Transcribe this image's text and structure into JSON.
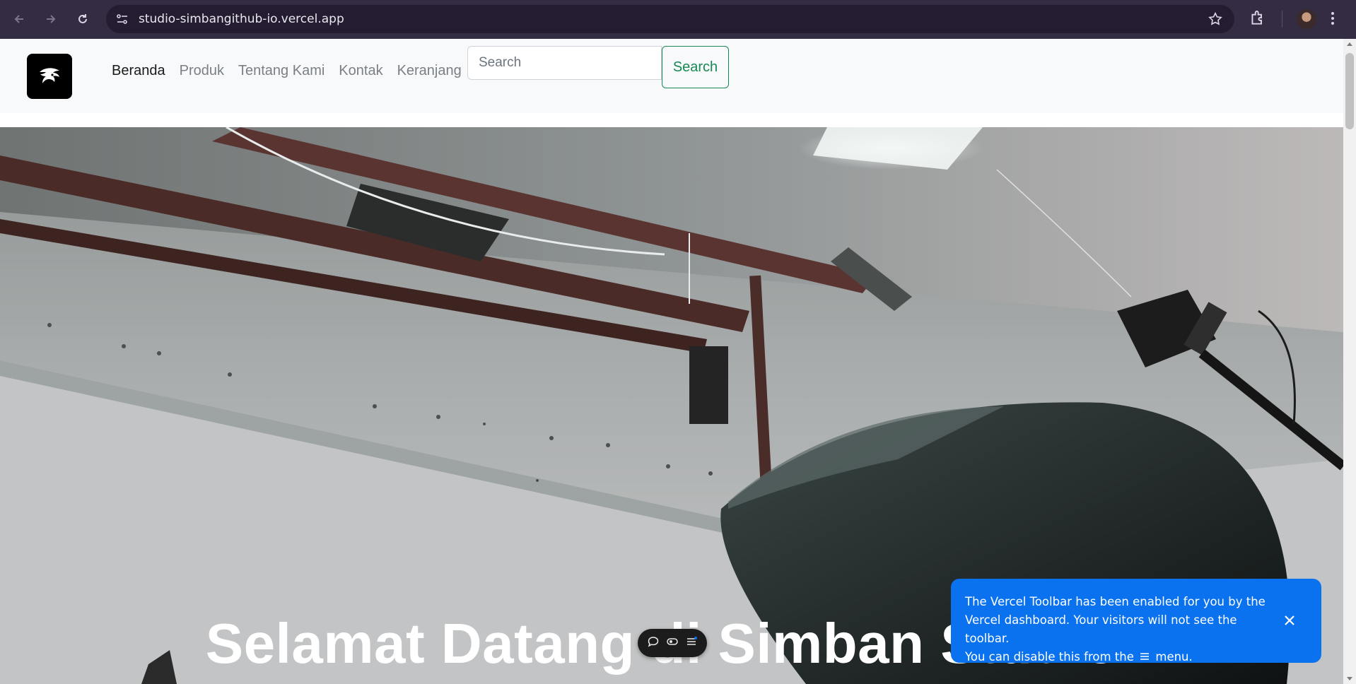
{
  "browser": {
    "url": "studio-simbangithub-io.vercel.app"
  },
  "navbar": {
    "links": [
      "Beranda",
      "Produk",
      "Tentang Kami",
      "Kontak",
      "Keranjang"
    ],
    "search_placeholder": "Search",
    "search_button": "Search"
  },
  "hero": {
    "title": "Selamat Datang di Simban Studio!"
  },
  "vercel_toast": {
    "line1": "The Vercel Toolbar has been enabled for you by the",
    "line2": "Vercel dashboard. Your visitors will not see the toolbar.",
    "line3_pre": "You can disable this from the",
    "line3_post": "menu."
  },
  "colors": {
    "chrome_bg": "#342c43",
    "navbar_bg": "#f8f9fa",
    "search_green": "#198754",
    "toast_blue": "#0a72ef"
  }
}
